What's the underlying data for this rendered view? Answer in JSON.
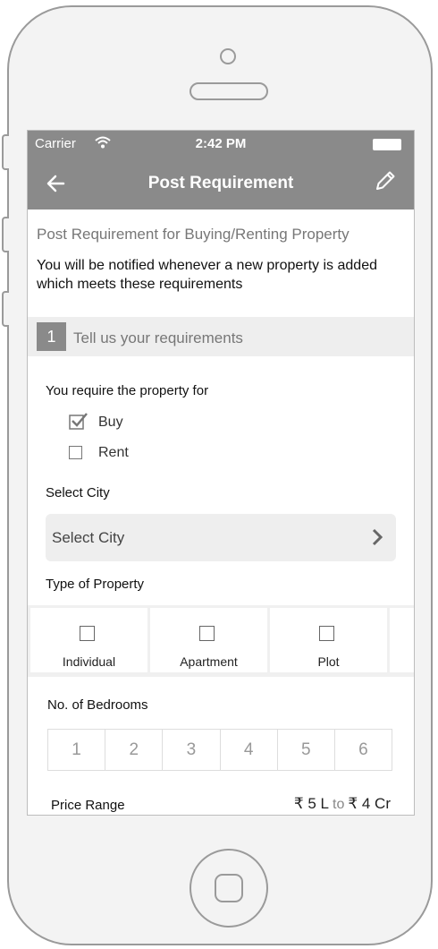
{
  "status_bar": {
    "carrier": "Carrier",
    "time": "2:42 PM"
  },
  "header": {
    "title": "Post Requirement"
  },
  "intro": {
    "heading": "Post Requirement for Buying/Renting Property",
    "text": "You will be notified whenever a new property is added which meets these requirements"
  },
  "step": {
    "number": "1",
    "label": "Tell us your requirements"
  },
  "purpose": {
    "label": "You require the property for",
    "options": [
      {
        "label": "Buy",
        "checked": true
      },
      {
        "label": "Rent",
        "checked": false
      }
    ]
  },
  "city": {
    "label": "Select City",
    "placeholder": "Select City"
  },
  "property_type": {
    "label": "Type of Property",
    "options": [
      "Individual",
      "Apartment",
      "Plot"
    ]
  },
  "bedrooms": {
    "label": "No. of Bedrooms",
    "options": [
      "1",
      "2",
      "3",
      "4",
      "5",
      "6"
    ]
  },
  "price": {
    "label": "Price Range",
    "min": "₹ 5 L",
    "to": "to",
    "max": "₹ 4 Cr"
  },
  "colors": {
    "header_bg": "#8a8a8a",
    "section_bg": "#eeeeee"
  },
  "icons": [
    "back-arrow-icon",
    "edit-pencil-icon",
    "wifi-icon",
    "battery-icon",
    "chevron-right-icon",
    "checkbox-icon"
  ]
}
